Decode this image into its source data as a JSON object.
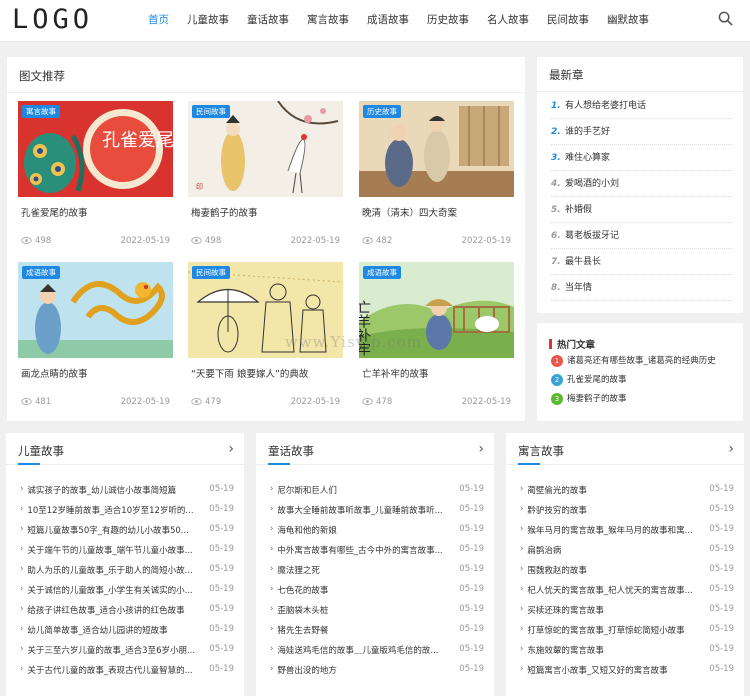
{
  "header": {
    "logo": "LOGO",
    "nav": [
      "首页",
      "儿童故事",
      "童话故事",
      "寓言故事",
      "成语故事",
      "历史故事",
      "名人故事",
      "民间故事",
      "幽默故事"
    ],
    "active_index": 0,
    "accent": "#1e88e5",
    "search_icon": "search-icon"
  },
  "featured": {
    "title": "图文推荐",
    "cards": [
      {
        "tag": "寓言故事",
        "title": "孔雀爱尾的故事",
        "views": "498",
        "date": "2022-05-19"
      },
      {
        "tag": "民间故事",
        "title": "梅妻鹤子的故事",
        "views": "498",
        "date": "2022-05-19"
      },
      {
        "tag": "历史故事",
        "title": "晚清（清末）四大奇案",
        "views": "482",
        "date": "2022-05-19"
      },
      {
        "tag": "成语故事",
        "title": "画龙点睛的故事",
        "views": "481",
        "date": "2022-05-19"
      },
      {
        "tag": "民间故事",
        "title": "“天要下雨 娘要嫁人”的典故",
        "views": "479",
        "date": "2022-05-19"
      },
      {
        "tag": "成语故事",
        "title": "亡羊补牢的故事",
        "views": "478",
        "date": "2022-05-19"
      }
    ],
    "img1_text": "孔雀爱尾",
    "img6_text": "亡羊补牢"
  },
  "latest": {
    "title": "最新章",
    "items": [
      "有人想给老婆打电话",
      "谁的手艺好",
      "难住心算家",
      "爱喝酒的小刘",
      "补婚假",
      "葛老板拔牙记",
      "最牛县长",
      "当年情"
    ]
  },
  "hot": {
    "title": "热门文章",
    "items": [
      "诸葛亮还有哪些故事_诸葛亮的经典历史",
      "孔雀爱尾的故事",
      "梅妻鹤子的故事"
    ]
  },
  "columns": [
    {
      "title": "儿童故事",
      "items": [
        {
          "t": "诚实孩子的故事_幼儿诚信小故事简短篇",
          "d": "05-19"
        },
        {
          "t": "10至12岁睡前故事_适合10岁至12岁听的...",
          "d": "05-19"
        },
        {
          "t": "短篇儿童故事50字_有趣的幼儿小故事50...",
          "d": "05-19"
        },
        {
          "t": "关于端午节的儿童故事_端午节儿童小故事...",
          "d": "05-19"
        },
        {
          "t": "助人为乐的儿童故事_乐于助人的简短小故...",
          "d": "05-19"
        },
        {
          "t": "关于诚信的儿童故事_小学生有关诚实的小...",
          "d": "05-19"
        },
        {
          "t": "给孩子讲红色故事_适合小孩讲的红色故事",
          "d": "05-19"
        },
        {
          "t": "幼儿简单故事_适合幼儿园讲的短故事",
          "d": "05-19"
        },
        {
          "t": "关于三至六岁儿童的故事_适合3至6岁小朋...",
          "d": "05-19"
        },
        {
          "t": "关于古代儿童的故事_表现古代儿童智慧的...",
          "d": "05-19"
        }
      ]
    },
    {
      "title": "童话故事",
      "items": [
        {
          "t": "尼尔斯和巨人们",
          "d": "05-19"
        },
        {
          "t": "故事大全睡前故事听故事_儿童睡前故事听...",
          "d": "05-19"
        },
        {
          "t": "海龟和他的新娘",
          "d": "05-19"
        },
        {
          "t": "中外寓言故事有哪些_古今中外的寓言故事...",
          "d": "05-19"
        },
        {
          "t": "魔法狸之死",
          "d": "05-19"
        },
        {
          "t": "七色花的故事",
          "d": "05-19"
        },
        {
          "t": "歪脑袋木头桩",
          "d": "05-19"
        },
        {
          "t": "猪先生去野餐",
          "d": "05-19"
        },
        {
          "t": "海娃送鸡毛信的故事＿儿童版鸡毛信的故...",
          "d": "05-19"
        },
        {
          "t": "野兽出没的地方",
          "d": "05-19"
        }
      ]
    },
    {
      "title": "寓言故事",
      "items": [
        {
          "t": "蔺壁偷光的故事",
          "d": "05-19"
        },
        {
          "t": "黔驴技穷的故事",
          "d": "05-19"
        },
        {
          "t": "猴年马月的寓言故事_猴年马月的故事和寓...",
          "d": "05-19"
        },
        {
          "t": "扁鹊治病",
          "d": "05-19"
        },
        {
          "t": "围魏救赵的故事",
          "d": "05-19"
        },
        {
          "t": "杞人忧天的寓言故事_杞人忧天的寓言故事...",
          "d": "05-19"
        },
        {
          "t": "买椟还珠的寓言故事",
          "d": "05-19"
        },
        {
          "t": "打草惊蛇的寓言故事_打草惊蛇简短小故事",
          "d": "05-19"
        },
        {
          "t": "东施效颦的寓言故事",
          "d": "05-19"
        },
        {
          "t": "短篇寓言小故事_又短又好的寓言故事",
          "d": "05-19"
        }
      ]
    }
  ],
  "watermark": "www.Yisvip.com"
}
